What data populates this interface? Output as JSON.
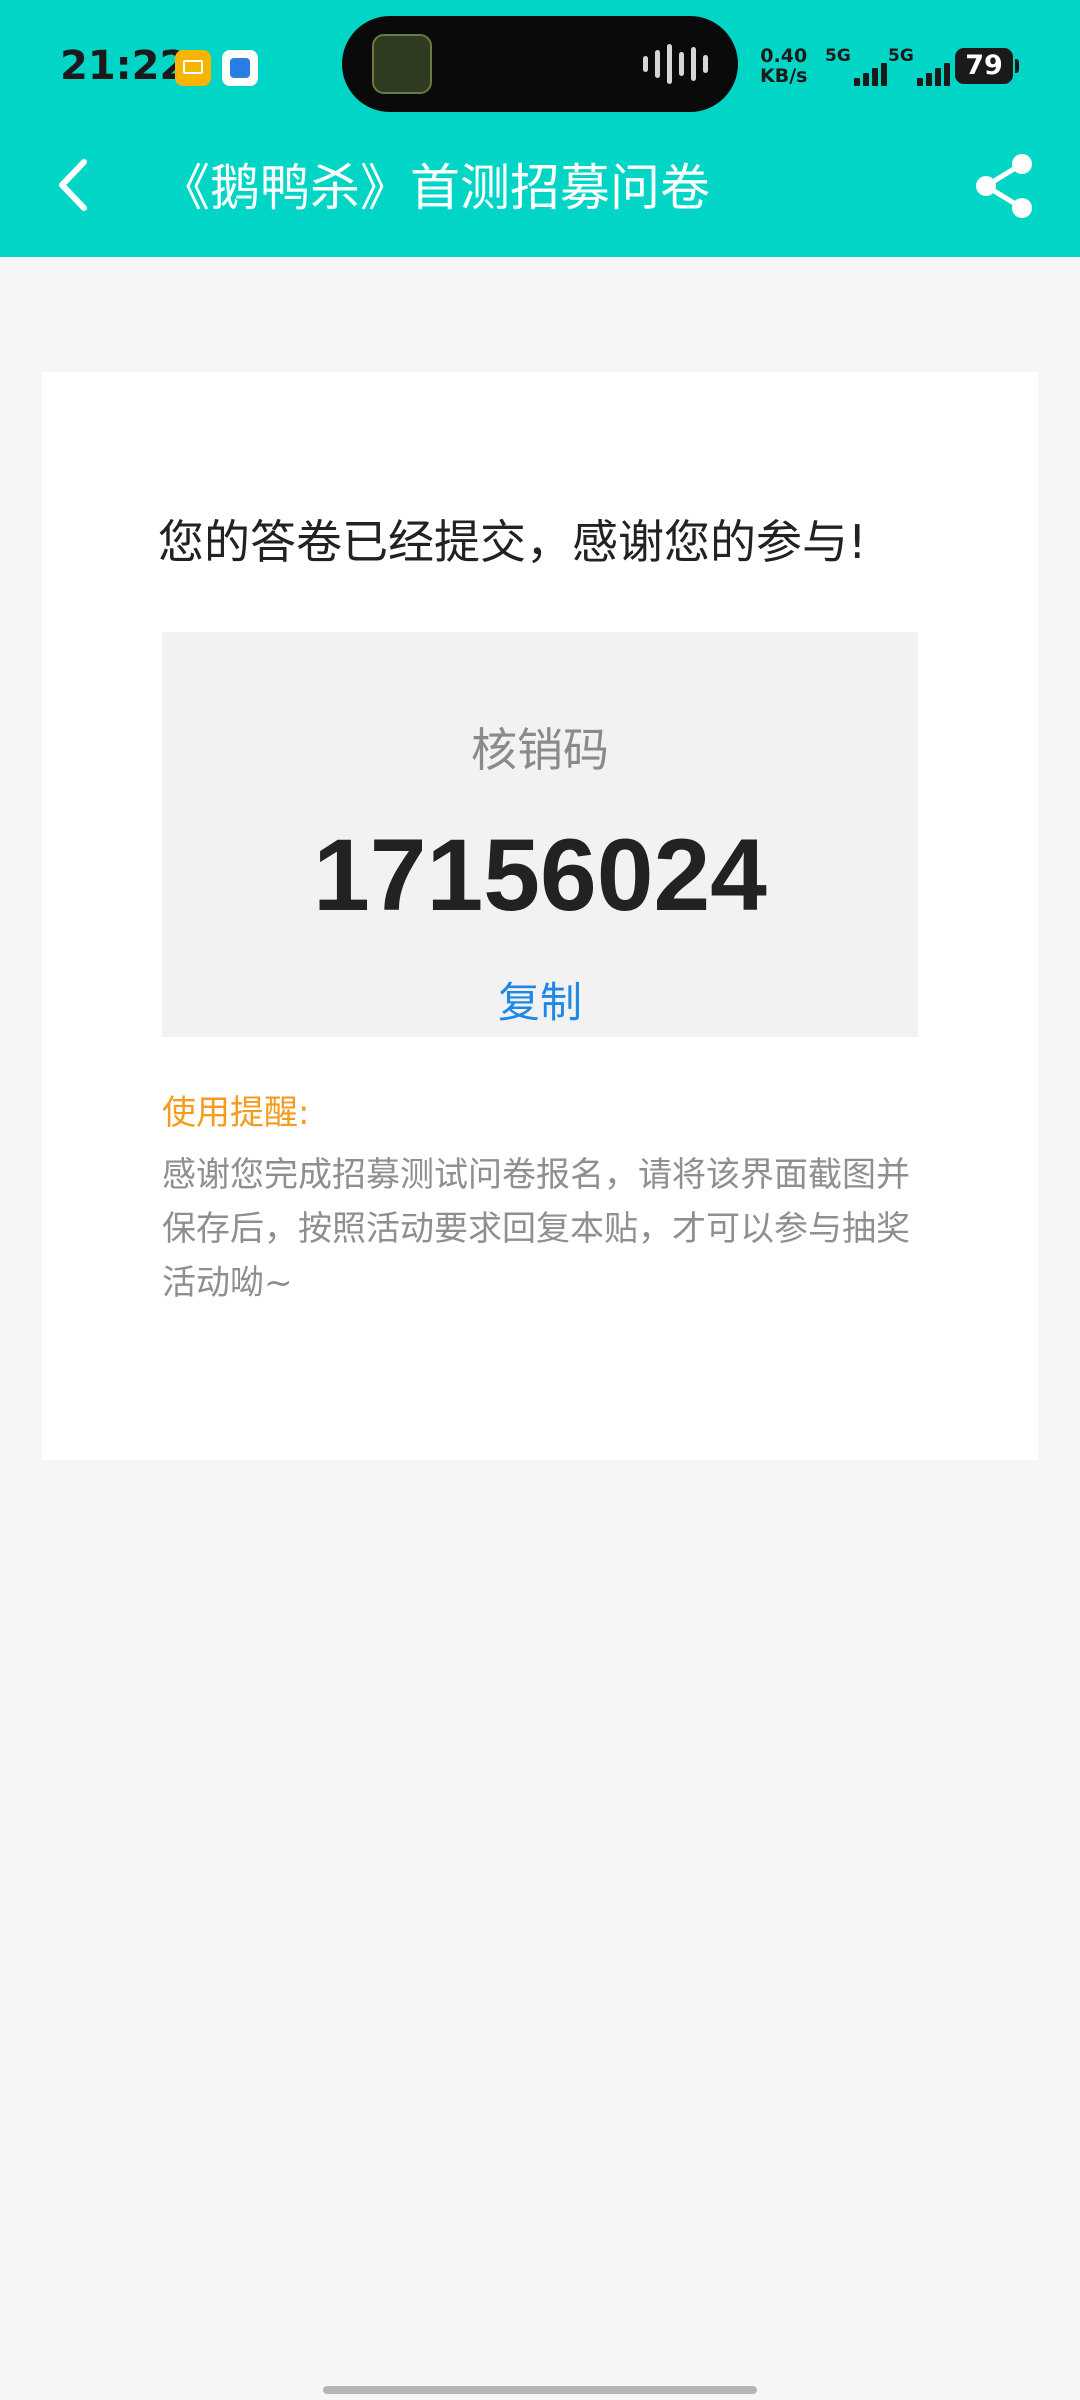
{
  "status_bar": {
    "time": "21:22",
    "net_speed_value": "0.40",
    "net_speed_unit": "KB/s",
    "sim1_label": "5G",
    "sim2_label": "5G",
    "battery": "79",
    "notification_icons": [
      "mail-icon",
      "app-notification-icon"
    ]
  },
  "header": {
    "title": "《鹅鸭杀》首测招募问卷",
    "back_icon": "chevron-left-icon",
    "share_icon": "share-icon"
  },
  "result": {
    "message": "您的答卷已经提交，感谢您的参与!",
    "code_label": "核销码",
    "code_value": "17156024",
    "copy_label": "复制",
    "reminder_title": "使用提醒:",
    "reminder_body": "感谢您完成招募测试问卷报名，请将该界面截图并保存后，按照活动要求回复本贴，才可以参与抽奖活动呦~"
  },
  "colors": {
    "header_bg": "#00d5c6",
    "page_bg": "#f6f6f6",
    "link": "#1f88e5",
    "reminder_accent": "#f39c1e"
  }
}
